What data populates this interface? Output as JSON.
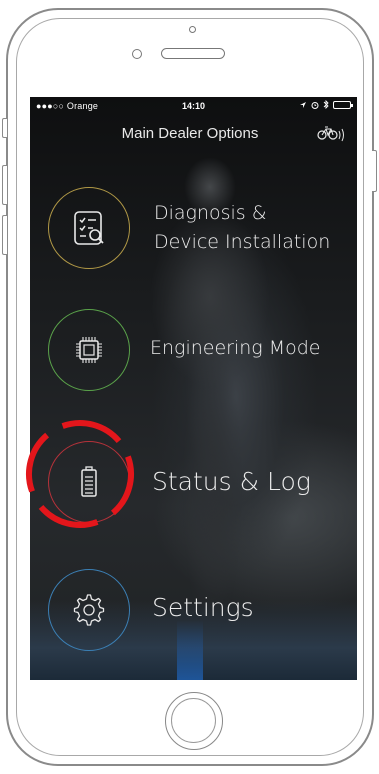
{
  "status_bar": {
    "carrier": "●●●○○ Orange",
    "time": "14:10"
  },
  "header": {
    "title": "Main Dealer Options",
    "bike_icon": "bike-connection-icon"
  },
  "menu": {
    "items": [
      {
        "label_line1": "Diagnosis &",
        "label_line2": "Device Installation",
        "icon": "checklist-search-icon",
        "ring_color": "#b09846"
      },
      {
        "label": "Engineering Mode",
        "icon": "chip-icon",
        "ring_color": "#5aa24a"
      },
      {
        "label": "Status & Log",
        "icon": "battery-icon",
        "ring_color": "#b5323a"
      },
      {
        "label": "Settings",
        "icon": "gear-icon",
        "ring_color": "#3b7fb4"
      }
    ]
  },
  "annotation": {
    "highlight_color": "#e3161b"
  }
}
